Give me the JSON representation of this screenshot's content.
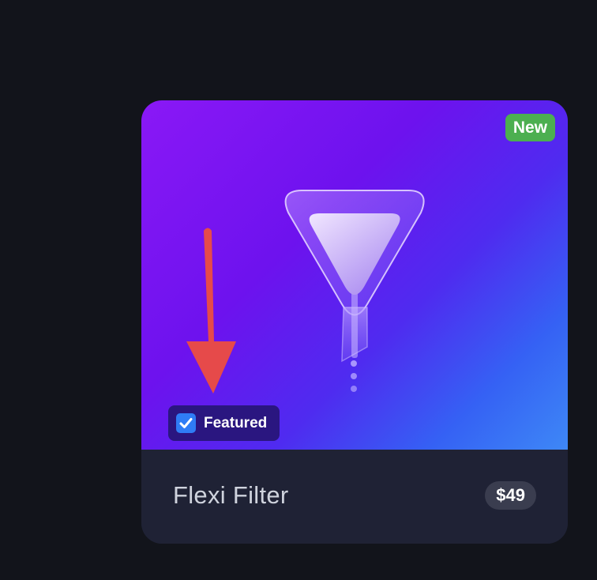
{
  "card": {
    "badge_new": "New",
    "featured": {
      "label": "Featured",
      "checked": true
    },
    "product_name": "Flexi Filter",
    "price": "$49",
    "hero_icon": "funnel-filter-icon"
  },
  "annotation": {
    "icon": "arrow-down-icon",
    "color": "#e64a4a"
  },
  "colors": {
    "background": "#12141b",
    "hero_gradient_start": "#8a18f6",
    "hero_gradient_end": "#3e88f6",
    "footer": "#1f2235",
    "new_badge": "#4caf50",
    "featured_chip": "#2a1680",
    "checkbox": "#2f7cf6"
  }
}
